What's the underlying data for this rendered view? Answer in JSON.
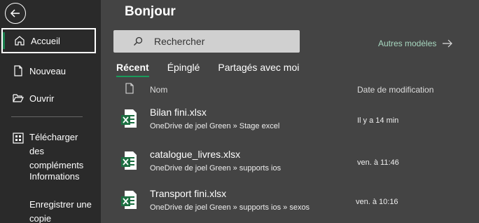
{
  "sidebar": {
    "back_label": "Retour",
    "items": [
      {
        "label": "Accueil",
        "icon": "home-icon"
      },
      {
        "label": "Nouveau",
        "icon": "new-document-icon"
      },
      {
        "label": "Ouvrir",
        "icon": "folder-open-icon"
      },
      {
        "label": "Télécharger des compléments",
        "icon": "addins-grid-icon"
      },
      {
        "label": "Informations"
      },
      {
        "label": "Enregistrer une copie"
      }
    ]
  },
  "main": {
    "title": "Bonjour",
    "search_placeholder": "Rechercher",
    "more_models": "Autres modèles",
    "tabs": [
      {
        "label": "Récent"
      },
      {
        "label": "Épinglé"
      },
      {
        "label": "Partagés avec moi"
      }
    ],
    "columns": {
      "name": "Nom",
      "date": "Date de modification"
    },
    "files": [
      {
        "name": "Bilan fini.xlsx",
        "path": "OneDrive de joel Green » Stage excel",
        "date": "Il y a 14 min"
      },
      {
        "name": "catalogue_livres.xlsx",
        "path": "OneDrive de joel Green » supports ios",
        "date": "ven. à 11:46"
      },
      {
        "name": "Transport fini.xlsx",
        "path": "OneDrive de joel Green » supports ios » sexos",
        "date": "ven. à 10:16"
      }
    ]
  },
  "colors": {
    "accent": "#1a7f4e",
    "excel_green": "#1d6f42",
    "sidebar_bg": "#2a2a2a",
    "main_bg": "#444444"
  }
}
